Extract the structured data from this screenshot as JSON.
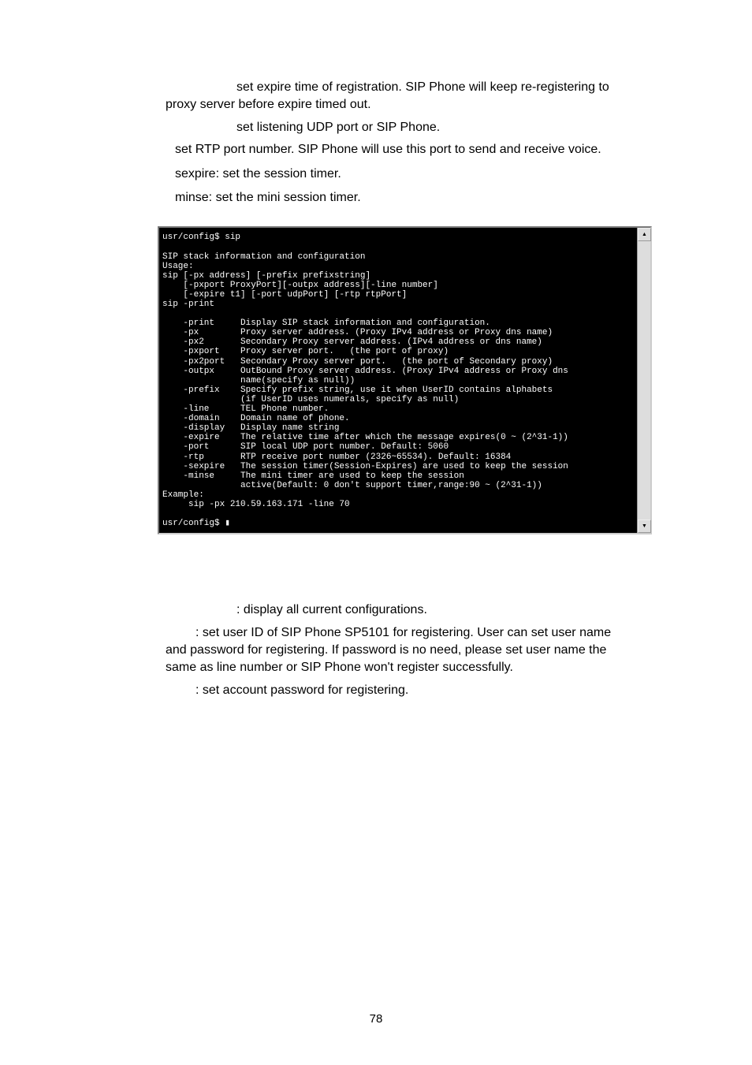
{
  "top_descriptions": [
    {
      "indent": "large",
      "text": "              set expire time of registration. SIP Phone will keep re-registering to proxy server before expire timed out."
    },
    {
      "indent": "large",
      "text": "         set listening UDP port or SIP Phone."
    },
    {
      "indent": "small",
      "text": "          set RTP port number. SIP Phone will use this port to send and receive voice."
    },
    {
      "indent": "small",
      "text": "sexpire: set the session timer."
    },
    {
      "indent": "small",
      "text": "minse: set the mini session timer."
    }
  ],
  "terminal_lines": [
    "usr/config$ sip",
    "",
    "SIP stack information and configuration",
    "Usage:",
    "sip [-px address] [-prefix prefixstring]",
    "    [-pxport ProxyPort][-outpx address][-line number]",
    "    [-expire t1] [-port udpPort] [-rtp rtpPort]",
    "sip -print",
    "",
    "    -print     Display SIP stack information and configuration.",
    "    -px        Proxy server address. (Proxy IPv4 address or Proxy dns name)",
    "    -px2       Secondary Proxy server address. (IPv4 address or dns name)",
    "    -pxport    Proxy server port.   (the port of proxy)",
    "    -px2port   Secondary Proxy server port.   (the port of Secondary proxy)",
    "    -outpx     OutBound Proxy server address. (Proxy IPv4 address or Proxy dns",
    "               name(specify as null))",
    "    -prefix    Specify prefix string, use it when UserID contains alphabets",
    "               (if UserID uses numerals, specify as null)",
    "    -line      TEL Phone number.",
    "    -domain    Domain name of phone.",
    "    -display   Display name string",
    "    -expire    The relative time after which the message expires(0 ~ (2^31-1))",
    "    -port      SIP local UDP port number. Default: 5060",
    "    -rtp       RTP receive port number (2326~65534). Default: 16384",
    "    -sexpire   The session timer(Session-Expires) are used to keep the session",
    "    -minse     The mini timer are used to keep the session",
    "               active(Default: 0 don't support timer,range:90 ~ (2^31-1))",
    "Example:",
    "     sip -px 210.59.163.171 -line 70",
    "",
    "usr/config$ ▮"
  ],
  "scrollbar": {
    "up": "▲",
    "down": "▼"
  },
  "bottom_descriptions": [
    {
      "indent": "large",
      "text": "            : display all current configurations."
    },
    {
      "indent": "small",
      "text": "               : set user ID of SIP Phone SP5101 for registering. User can set user name and password for registering. If password is no need, please set user name the same as line number or SIP Phone won't register successfully."
    },
    {
      "indent": "small",
      "text": "         : set account password for registering."
    }
  ],
  "page_number": "78"
}
